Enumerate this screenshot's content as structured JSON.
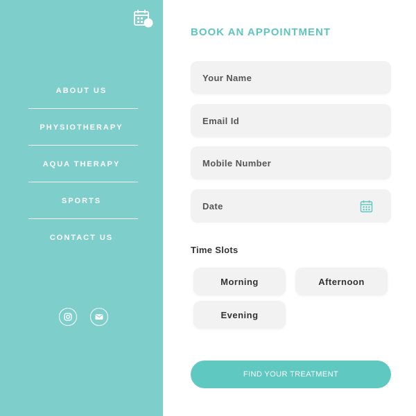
{
  "colors": {
    "sidebar": "#7ecfcc",
    "accent": "#5cc6bf",
    "button": "#5ec8c1",
    "field_bg": "#f2f2f2"
  },
  "sidebar": {
    "top_icon": "calendar-icon",
    "nav": [
      {
        "label": "ABOUT US"
      },
      {
        "label": "PHYSIOTHERAPY"
      },
      {
        "label": "AQUA THERAPY"
      },
      {
        "label": "SPORTS"
      },
      {
        "label": "CONTACT US"
      }
    ],
    "socials": [
      "instagram-icon",
      "email-icon"
    ]
  },
  "form": {
    "title": "BOOK AN APPOINTMENT",
    "name_placeholder": "Your Name",
    "email_placeholder": "Email Id",
    "mobile_placeholder": "Mobile Number",
    "date_placeholder": "Date",
    "time_slots_label": "Time Slots",
    "slots": [
      "Morning",
      "Afternoon",
      "Evening"
    ],
    "submit_label": "FIND YOUR TREATMENT"
  }
}
